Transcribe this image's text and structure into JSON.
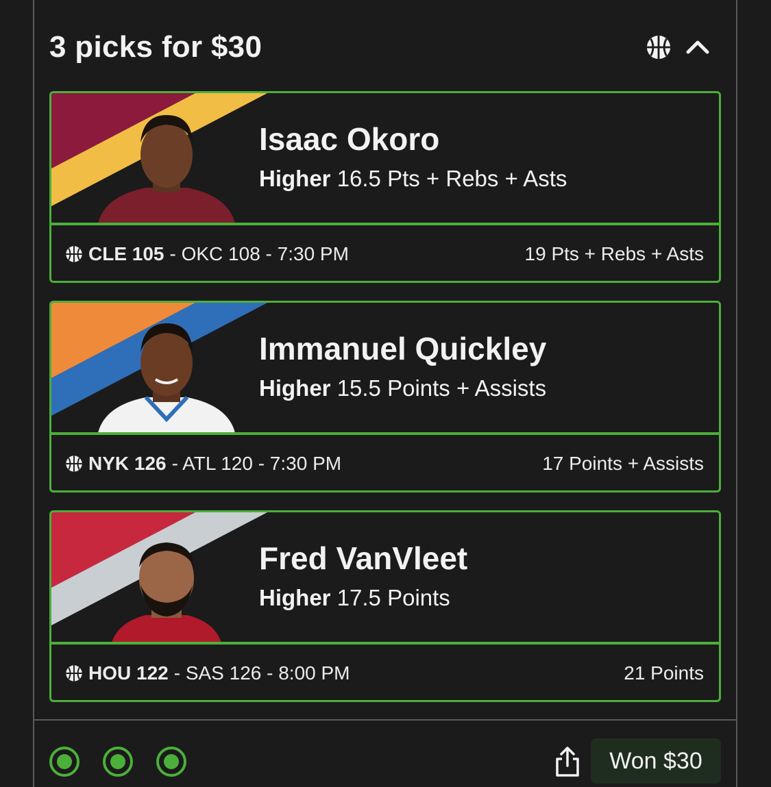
{
  "header": {
    "title": "3 picks for $30",
    "sport_icon": "basketball-icon",
    "collapse_icon": "chevron-up-icon"
  },
  "colors": {
    "accent_green": "#4caf3a",
    "background": "#1b1b1b"
  },
  "picks": [
    {
      "player": "Isaac Okoro",
      "direction": "Higher",
      "line": "16.5 Pts + Rebs + Asts",
      "team_score": "CLE 105",
      "game_rest": "- OKC 108 - 7:30 PM",
      "result": "19 Pts + Rebs + Asts",
      "stripe_colors": [
        "#8b1a3d",
        "#f2bd45"
      ],
      "jersey_color": "#7a1f2b"
    },
    {
      "player": "Immanuel Quickley",
      "direction": "Higher",
      "line": "15.5 Points + Assists",
      "team_score": "NYK 126",
      "game_rest": "- ATL 120 - 7:30 PM",
      "result": "17 Points + Assists",
      "stripe_colors": [
        "#ef8a3a",
        "#2f6fb9"
      ],
      "jersey_color": "#f2f2f2"
    },
    {
      "player": "Fred VanVleet",
      "direction": "Higher",
      "line": "17.5 Points",
      "team_score": "HOU 122",
      "game_rest": "- SAS 126 - 8:00 PM",
      "result": "21 Points",
      "stripe_colors": [
        "#c8283d",
        "#c9ced3"
      ],
      "jersey_color": "#b11a2b"
    }
  ],
  "footer": {
    "status_dots": [
      "won",
      "won",
      "won"
    ],
    "share_icon": "share-icon",
    "won_label": "Won $30"
  }
}
